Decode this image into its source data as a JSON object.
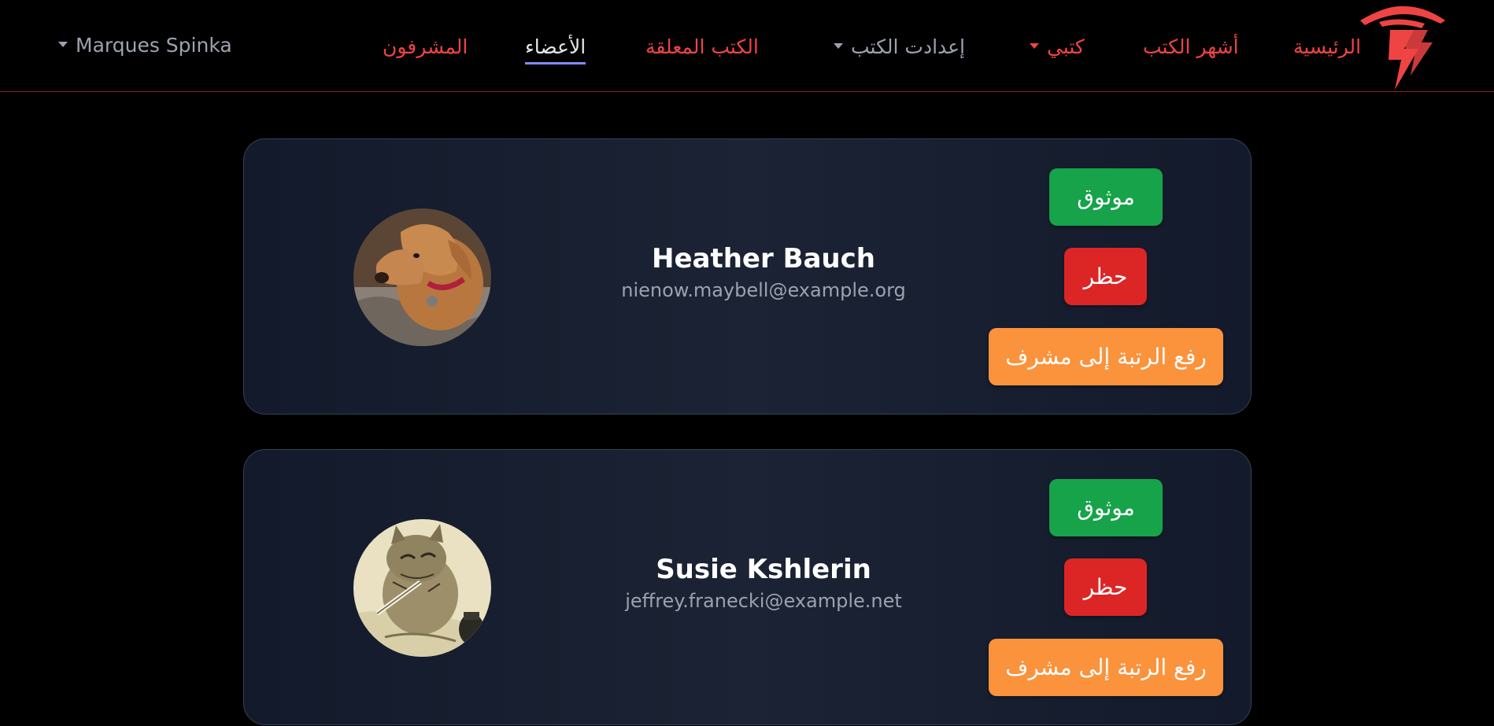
{
  "nav": {
    "home": "الرئيسية",
    "popular_books": "أشهر الكتب",
    "my_books": "كتبي",
    "book_settings": "إعدادت الكتب",
    "pending_books": "الكتب المعلقة",
    "members": "الأعضاء",
    "moderators": "المشرفون",
    "user_name": "Marques Spinka",
    "active_item": "members"
  },
  "colors": {
    "brand_red": "#ef4444",
    "verify_green": "#16a34a",
    "ban_red": "#dc2626",
    "promote_orange": "#fb923c",
    "active_underline": "#818cf8"
  },
  "members": [
    {
      "name": "Heather Bauch",
      "email": "nienow.maybell@example.org",
      "avatar": "dog-photo",
      "verify_label": "موثوق",
      "ban_label": "حظر",
      "promote_label": "رفع الرتبة إلى مشرف"
    },
    {
      "name": "Susie Kshlerin",
      "email": "jeffrey.franecki@example.net",
      "avatar": "cat-writing-illustration",
      "verify_label": "موثوق",
      "ban_label": "حظر",
      "promote_label": "رفع الرتبة إلى مشرف"
    }
  ]
}
